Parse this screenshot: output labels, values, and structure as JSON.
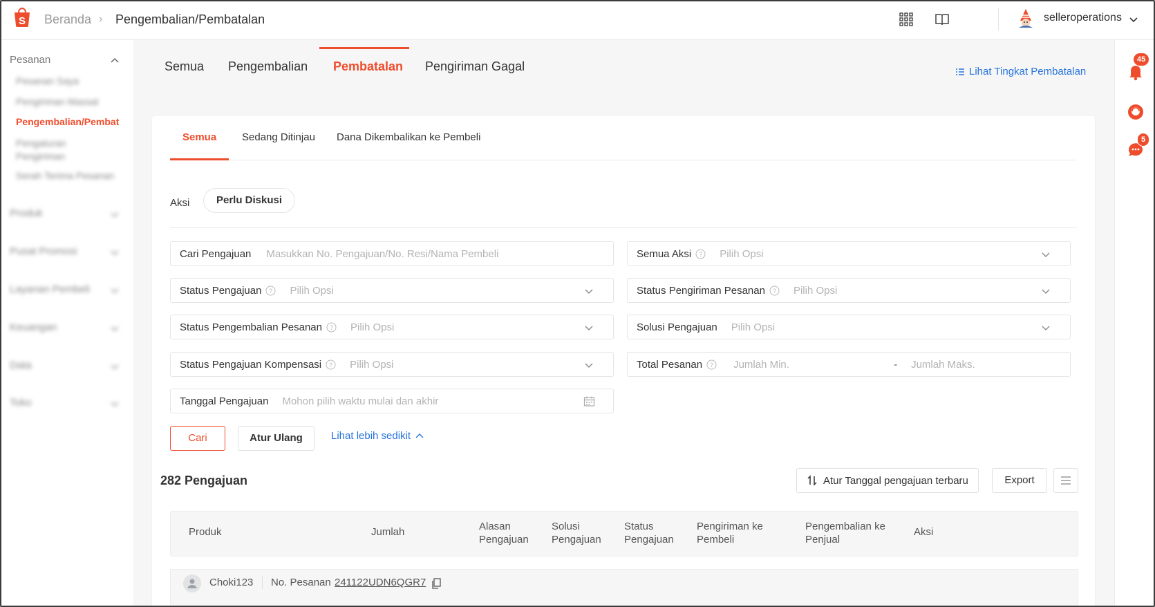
{
  "breadcrumb": {
    "home": "Beranda",
    "current": "Pengembalian/Pembatalan"
  },
  "user": {
    "name": "selleroperations"
  },
  "sidebar": {
    "sections": [
      {
        "label": "Pesanan",
        "expanded": true
      },
      {
        "label": "Produk"
      },
      {
        "label": "Pusat Promosi"
      },
      {
        "label": "Layanan Pembeli"
      },
      {
        "label": "Keuangan"
      },
      {
        "label": "Data"
      },
      {
        "label": "Toko"
      }
    ],
    "items": [
      {
        "label": "Pesanan Saya"
      },
      {
        "label": "Pengiriman Massal"
      },
      {
        "label": "Pengembalian/Pembat",
        "active": true
      },
      {
        "label": "Pengaturan Pengiriman"
      },
      {
        "label": "Serah Terima Pesanan"
      }
    ]
  },
  "rail": {
    "notif_badge": "45",
    "chat_badge": "5"
  },
  "main_tabs": [
    {
      "label": "Semua"
    },
    {
      "label": "Pengembalian"
    },
    {
      "label": "Pembatalan",
      "active": true
    },
    {
      "label": "Pengiriman Gagal"
    }
  ],
  "view_rate_link": "Lihat Tingkat Pembatalan",
  "sub_tabs": [
    {
      "label": "Semua",
      "active": true
    },
    {
      "label": "Sedang Ditinjau"
    },
    {
      "label": "Dana Dikembalikan ke Pembeli"
    }
  ],
  "action": {
    "label": "Aksi",
    "pill": "Perlu Diskusi"
  },
  "filters": {
    "search": {
      "label": "Cari Pengajuan",
      "placeholder": "Masukkan No. Pengajuan/No. Resi/Nama Pembeli"
    },
    "all_actions": {
      "label": "Semua Aksi",
      "placeholder": "Pilih Opsi"
    },
    "request_status": {
      "label": "Status Pengajuan",
      "placeholder": "Pilih Opsi"
    },
    "shipping_status": {
      "label": "Status Pengiriman Pesanan",
      "placeholder": "Pilih Opsi"
    },
    "return_status": {
      "label": "Status Pengembalian Pesanan",
      "placeholder": "Pilih Opsi"
    },
    "solution": {
      "label": "Solusi Pengajuan",
      "placeholder": "Pilih Opsi"
    },
    "compensation_status": {
      "label": "Status Pengajuan Kompensasi",
      "placeholder": "Pilih Opsi"
    },
    "order_total": {
      "label": "Total Pesanan",
      "min_placeholder": "Jumlah Min.",
      "separator": "-",
      "max_placeholder": "Jumlah Maks."
    },
    "date": {
      "label": "Tanggal Pengajuan",
      "placeholder": "Mohon pilih waktu mulai dan akhir"
    }
  },
  "buttons": {
    "search": "Cari",
    "reset": "Atur Ulang",
    "see_less": "Lihat lebih sedikit"
  },
  "results": {
    "count_text": "282 Pengajuan",
    "sort_label": "Atur Tanggal pengajuan terbaru",
    "export": "Export"
  },
  "table": {
    "headers": [
      "Produk",
      "Jumlah",
      "Alasan Pengajuan",
      "Solusi Pengajuan",
      "Status Pengajuan",
      "Pengiriman ke Pembeli",
      "Pengembalian ke Penjual",
      "Aksi"
    ]
  },
  "order": {
    "buyer": "Choki123",
    "order_label": "No. Pesanan",
    "order_no": "241122UDN6QGR7"
  },
  "colors": {
    "brand": "#ee4d2d",
    "link": "#2673dd"
  }
}
